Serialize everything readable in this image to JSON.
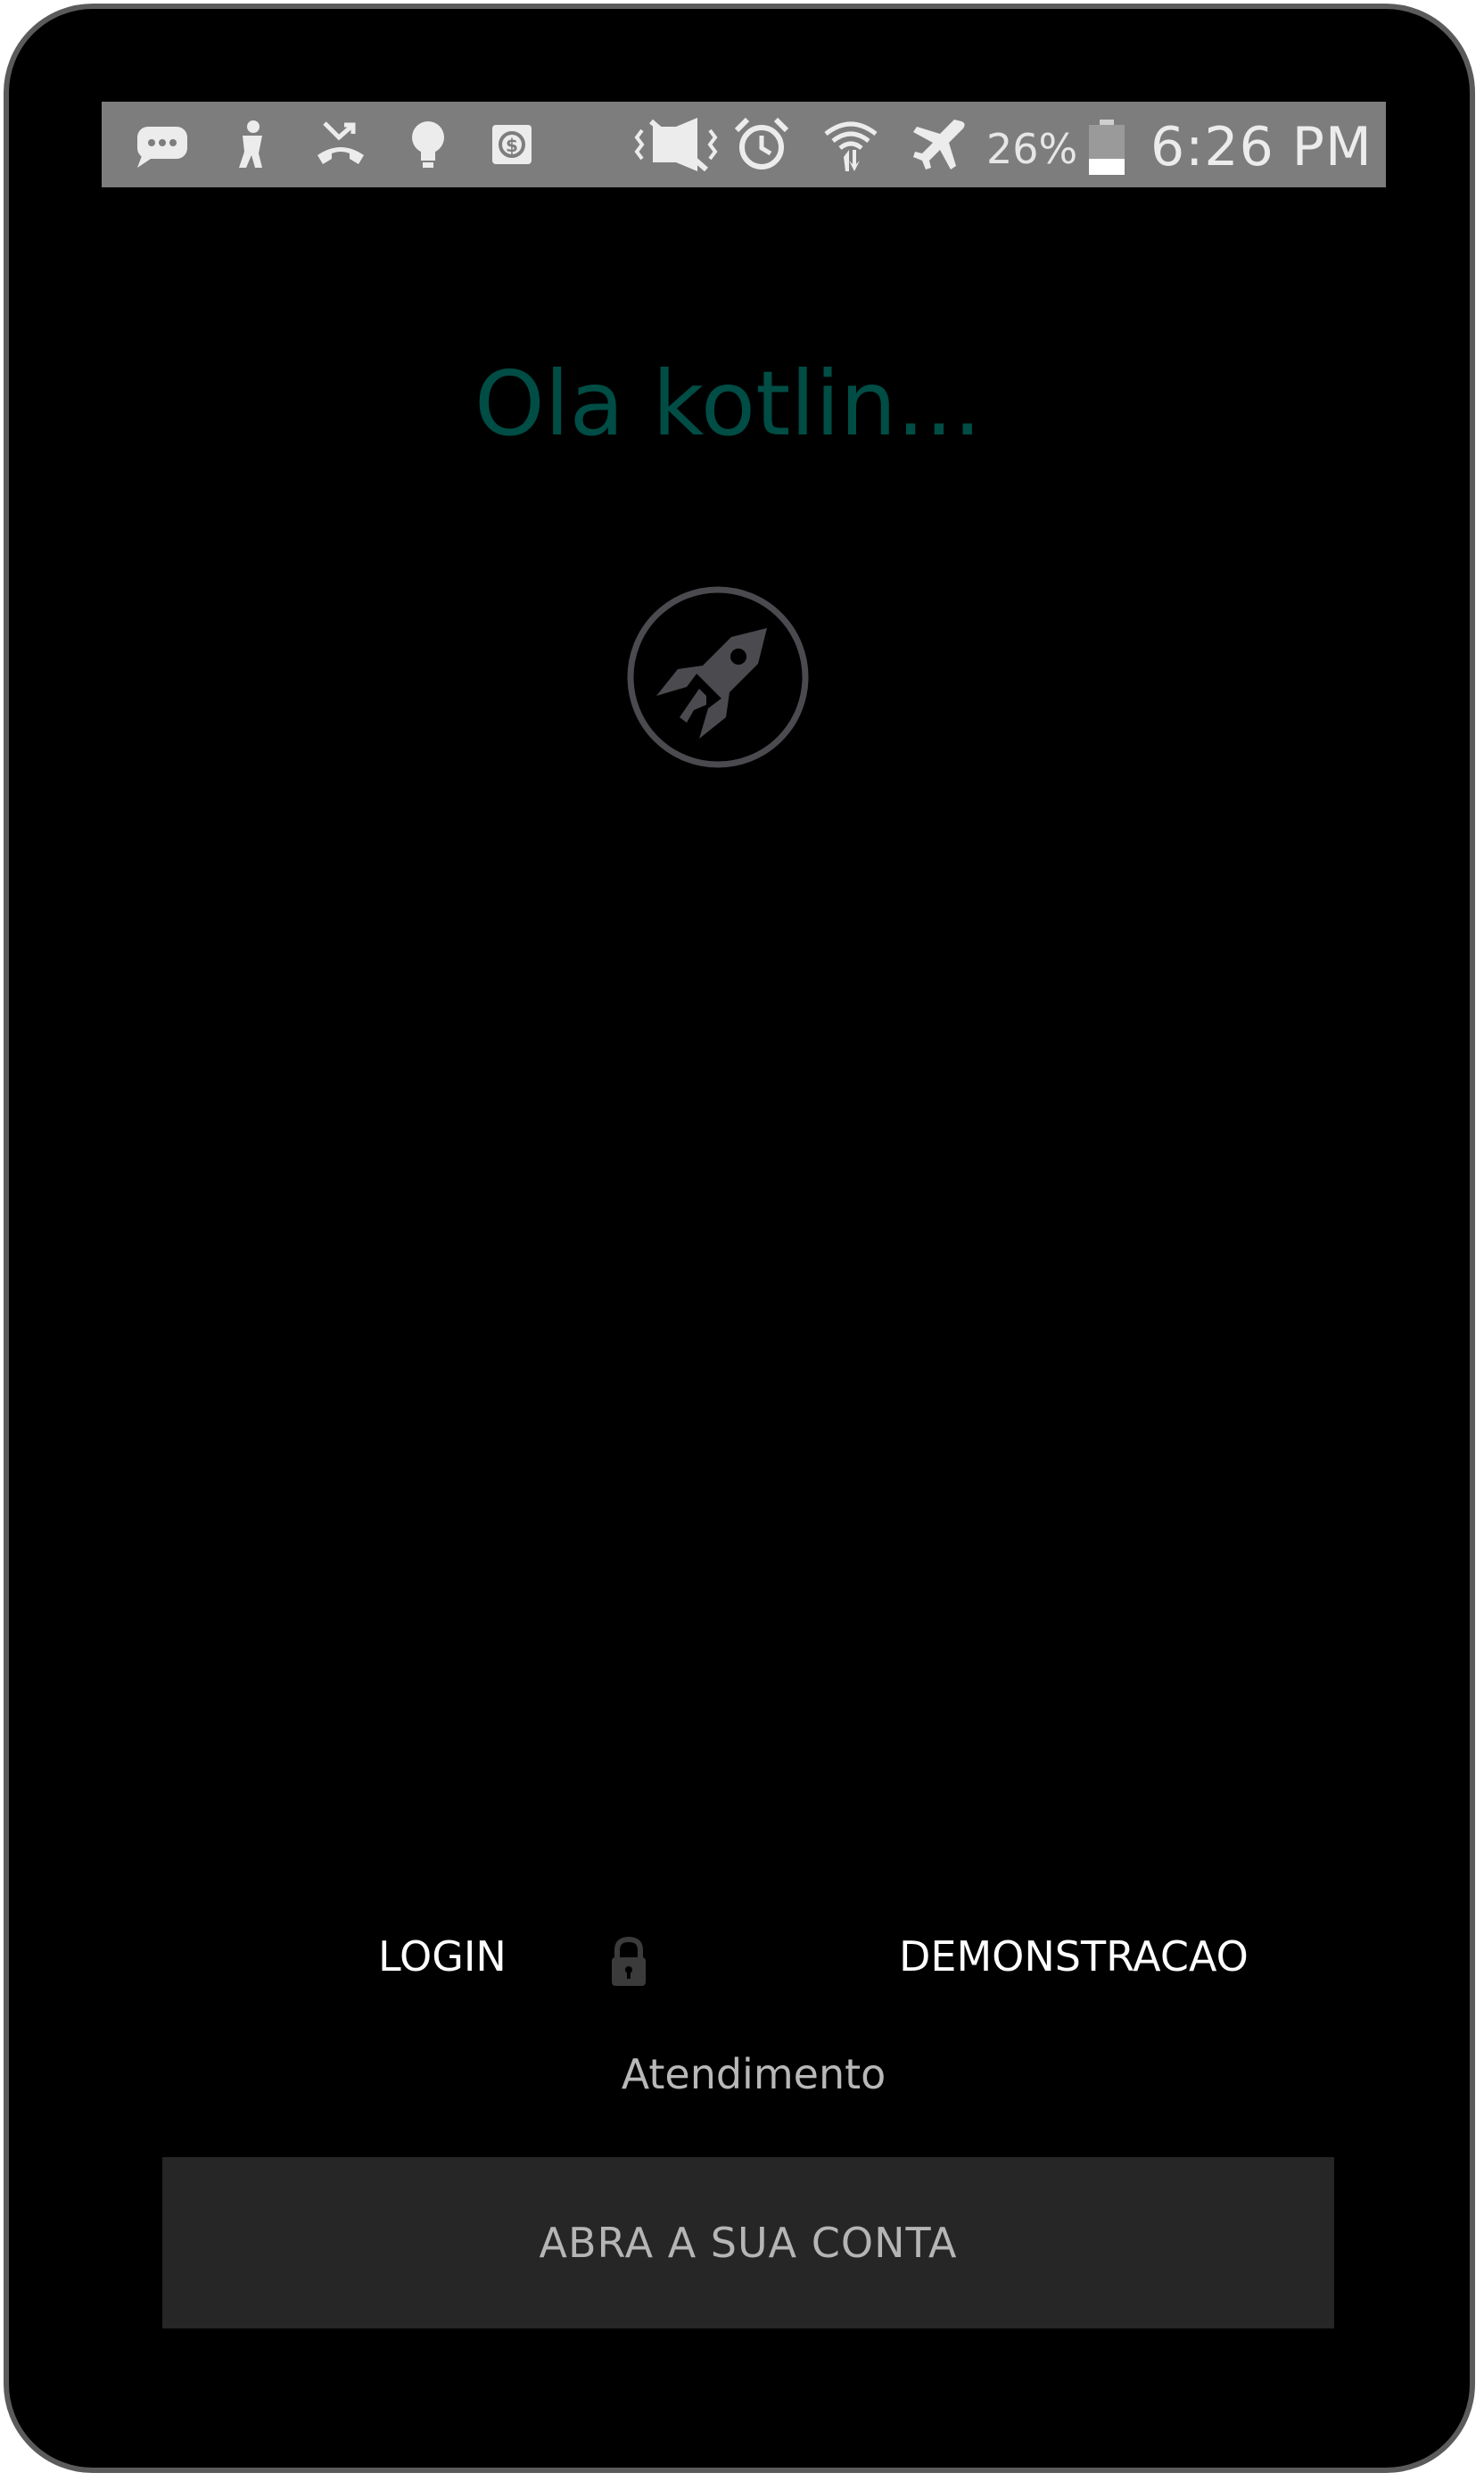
{
  "status_bar": {
    "icons": [
      "messages-icon",
      "person-icon",
      "missed-call-icon",
      "bulb-icon",
      "dollar-icon",
      "mute-icon",
      "alarm-icon",
      "wifi-icon",
      "airplane-icon"
    ],
    "battery_percent": "26%",
    "time": "6:26 PM"
  },
  "app": {
    "title": "Ola kotlin...",
    "logo_icon": "rocket-icon",
    "login_label": "LOGIN",
    "lock_icon": "lock-icon",
    "demo_label": "DEMONSTRACAO",
    "support_label": "Atendimento",
    "open_account_label": "ABRA A SUA CONTA"
  },
  "colors": {
    "background": "#000000",
    "title": "#004d45",
    "button": "#262626",
    "statusbar": "#7d7d7d"
  }
}
